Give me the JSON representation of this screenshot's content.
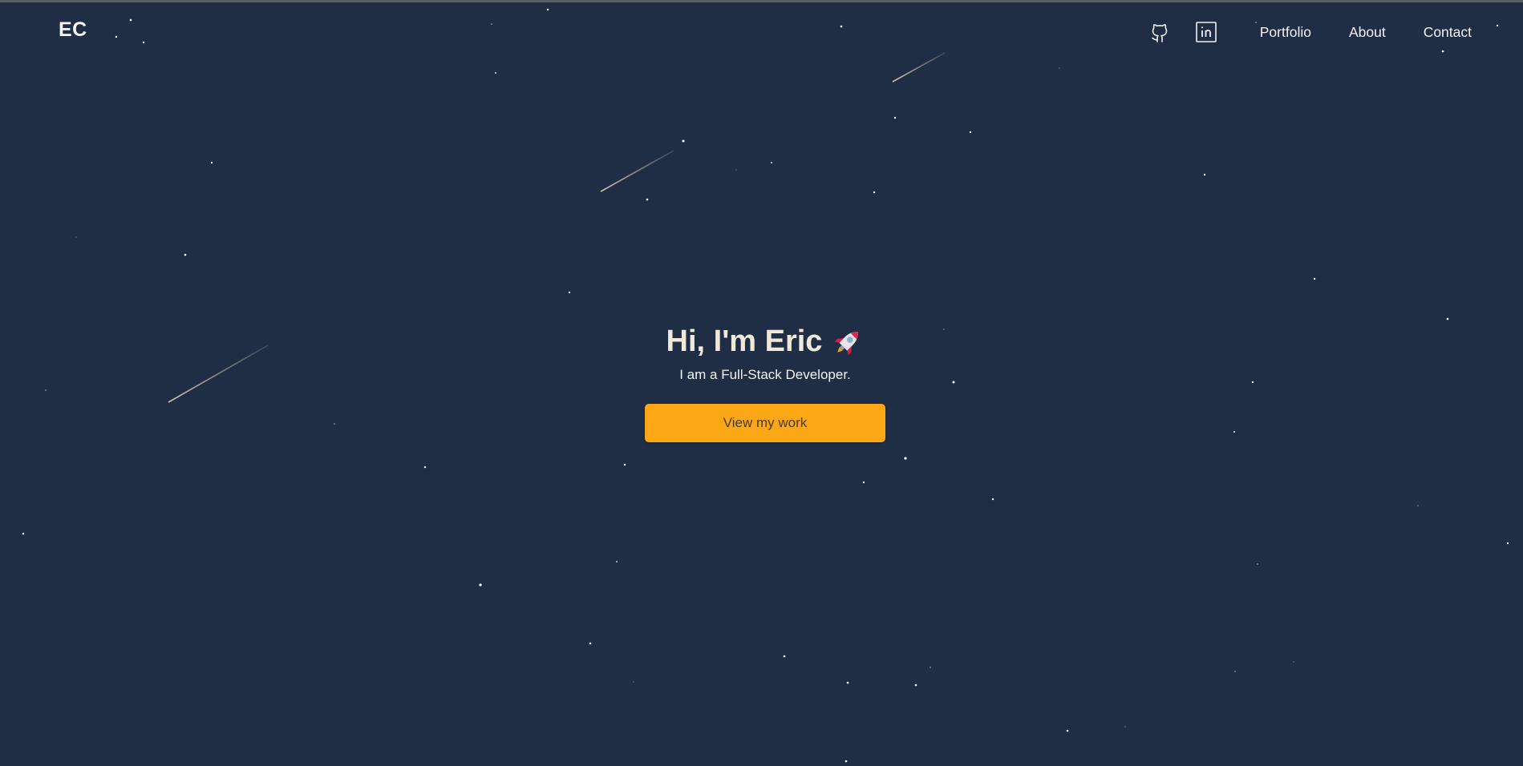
{
  "theme": {
    "background": "#1f2d45",
    "accent": "#fba716",
    "title_color": "#efe9dc",
    "text_color": "#f2f2f2"
  },
  "nav": {
    "logo": "EC",
    "social_icons": [
      "github-icon",
      "linkedin-icon"
    ],
    "links": [
      "Portfolio",
      "About",
      "Contact"
    ]
  },
  "hero": {
    "title": "Hi, I'm Eric",
    "title_icon": "rocket-icon",
    "subtitle": "I am a Full-Stack Developer.",
    "cta_label": "View my work"
  }
}
